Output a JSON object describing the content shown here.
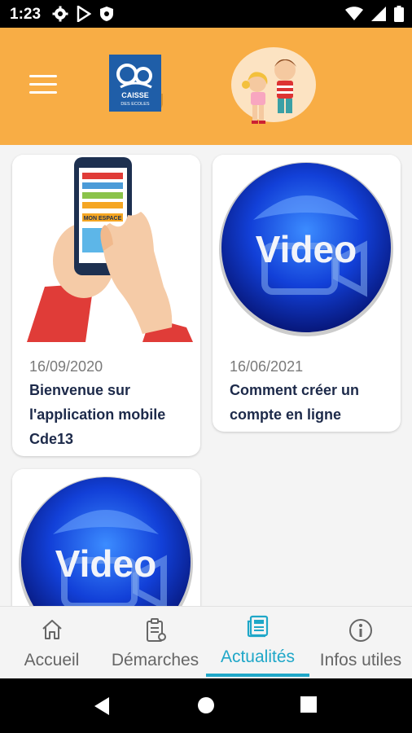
{
  "status_bar": {
    "time": "1:23",
    "left_icons": [
      "gear-icon",
      "play-store-icon",
      "shield-icon"
    ],
    "right_icons": [
      "wifi-icon",
      "signal-icon",
      "battery-icon"
    ]
  },
  "header": {
    "accent_color": "#F8AD45",
    "logo_text": "CAISSE",
    "logo_subtext": "DES ECOLES"
  },
  "articles": [
    {
      "image": "phone-hand-illustration",
      "image_caption": "MON ESPACE",
      "date": "16/09/2020",
      "title": "Bienvenue sur l'application mobile Cde13"
    },
    {
      "image": "video-badge",
      "image_caption": "Video",
      "date": "16/06/2021",
      "title": "Comment créer un compte en ligne"
    },
    {
      "image": "video-badge",
      "image_caption": "Video",
      "date": "",
      "title": ""
    }
  ],
  "bottom_nav": {
    "active_color": "#1FA7C8",
    "items": [
      {
        "label": "Accueil",
        "icon": "home-icon"
      },
      {
        "label": "Démarches",
        "icon": "clipboard-icon"
      },
      {
        "label": "Actualités",
        "icon": "news-icon",
        "active": true
      },
      {
        "label": "Infos utiles",
        "icon": "info-icon"
      }
    ]
  }
}
